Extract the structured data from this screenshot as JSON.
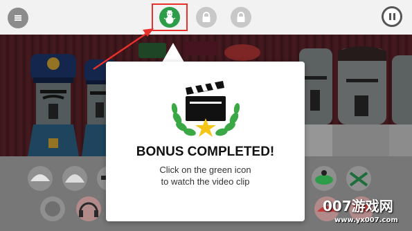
{
  "topbar": {
    "menu_icon": "hamburger-icon",
    "bonus_slots": [
      {
        "icon": "snowman-icon",
        "state": "unlocked",
        "color": "#2e9d4a",
        "highlighted": true
      },
      {
        "icon": "lock-icon",
        "state": "locked",
        "color": "#c8c8c8"
      },
      {
        "icon": "lock-icon",
        "state": "locked",
        "color": "#c8c8c8"
      }
    ],
    "pause_icon": "pause-icon"
  },
  "popup": {
    "icon": "clapperboard-laurel-star-icon",
    "title": "BONUS COMPLETED!",
    "message_line1": "Click on the green icon",
    "message_line2": "to watch the video clip"
  },
  "colors": {
    "accent_green": "#2e9d4a",
    "highlight_red": "#e8312a",
    "star_yellow": "#f5c518"
  },
  "watermark": {
    "text": "007游戏网",
    "url": "www.yx007.com"
  }
}
